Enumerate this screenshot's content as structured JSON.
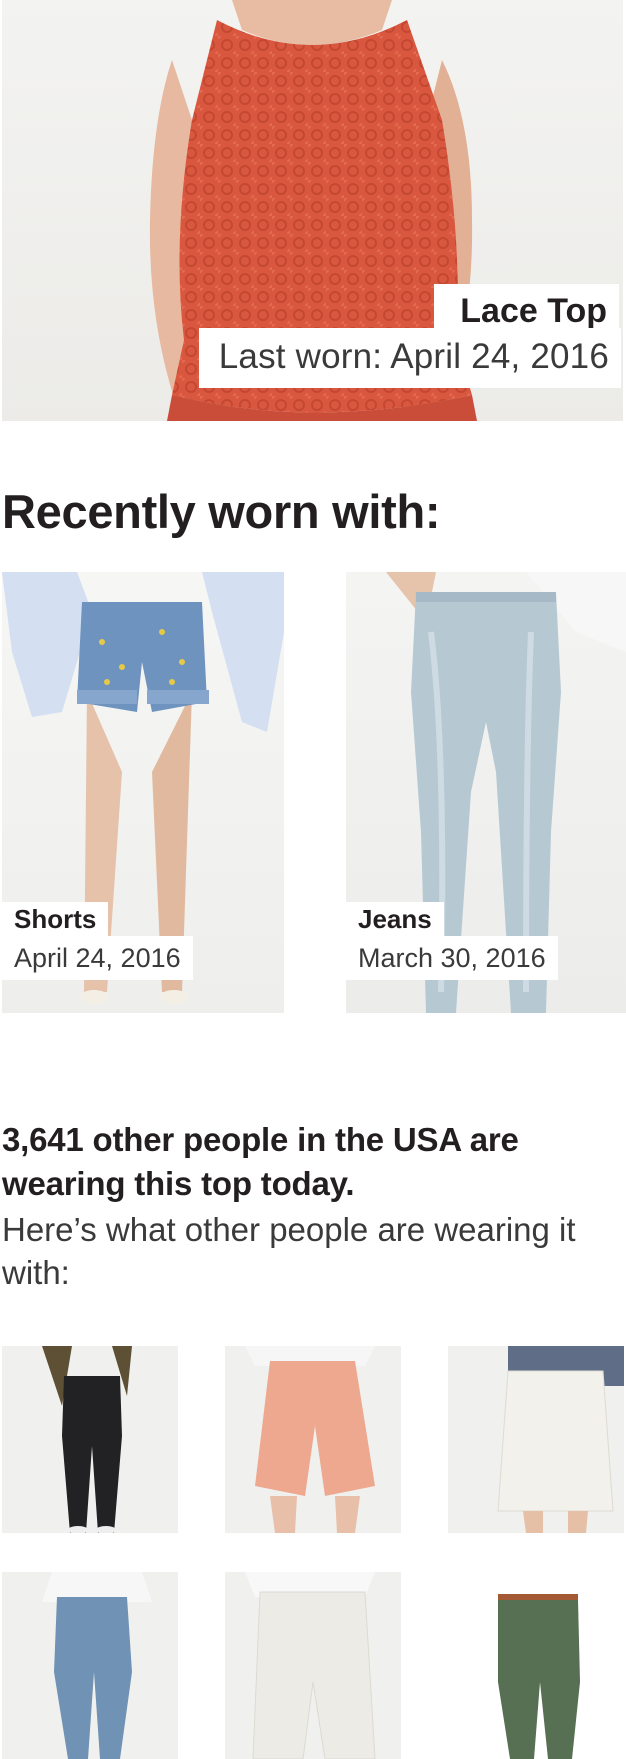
{
  "hero": {
    "item_name": "Lace Top",
    "last_worn": "Last worn: April 24, 2016",
    "garment_color": "#d9573f"
  },
  "recent": {
    "heading": "Recently worn with:",
    "items": [
      {
        "name": "Shorts",
        "date": "April 24, 2016",
        "color": "#6f93bf"
      },
      {
        "name": "Jeans",
        "date": "March 30, 2016",
        "color": "#b6c9d3"
      }
    ]
  },
  "others": {
    "heading": "3,641 other people in the USA are wearing this top today.",
    "subheading": "Here’s what other people are wearing it with:",
    "items": [
      {
        "icon": "black-jeans",
        "color": "#222225"
      },
      {
        "icon": "peach-shorts",
        "color": "#eda88f"
      },
      {
        "icon": "white-skirt",
        "color": "#f2f1ec"
      },
      {
        "icon": "blue-jeans",
        "color": "#6f92b5"
      },
      {
        "icon": "white-shorts",
        "color": "#ecebe6"
      },
      {
        "icon": "green-trousers",
        "color": "#576f52"
      }
    ]
  }
}
